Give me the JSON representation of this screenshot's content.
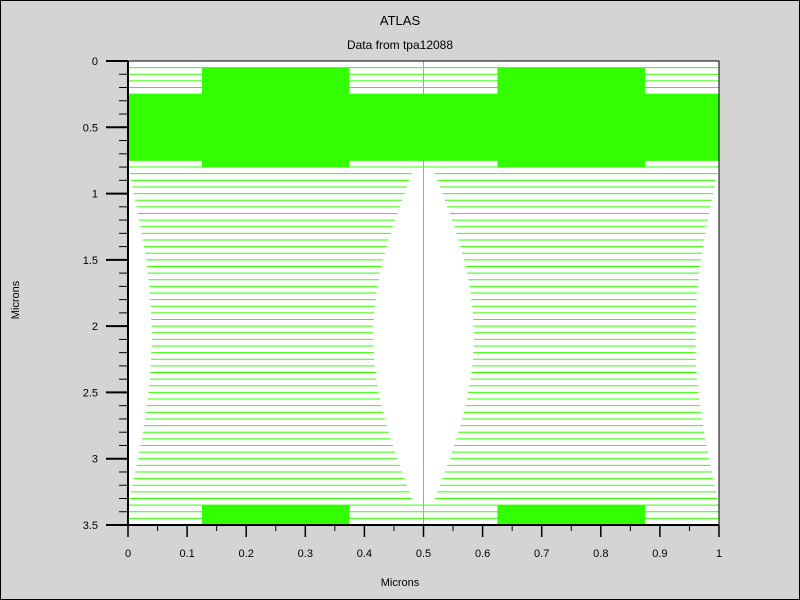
{
  "window": {
    "title": "ATLAS",
    "subtitle": "Data from tpa12088"
  },
  "colors": {
    "mesh": "#33ff00",
    "background": "#d4d4d4",
    "plot_bg": "#ffffff",
    "axis": "#000000"
  },
  "chart_data": {
    "type": "mesh",
    "title": "ATLAS",
    "subtitle": "Data from tpa12088",
    "xlabel": "Microns",
    "ylabel": "Microns",
    "xlim": [
      0,
      1
    ],
    "ylim": [
      3.5,
      0
    ],
    "y_inverted": true,
    "x_ticks": [
      "0",
      "0.1",
      "0.2",
      "0.3",
      "0.4",
      "0.5",
      "0.6",
      "0.7",
      "0.8",
      "0.9",
      "1"
    ],
    "y_ticks": [
      "0",
      "0.5",
      "1",
      "1.5",
      "2",
      "2.5",
      "3",
      "3.5"
    ],
    "dense_regions": [
      {
        "y_from": 0.25,
        "y_to": 0.75,
        "x_from": 0,
        "x_to": 1
      },
      {
        "y_from": 0.05,
        "y_to": 0.8,
        "x_from": 0.125,
        "x_to": 0.375
      },
      {
        "y_from": 0.05,
        "y_to": 0.8,
        "x_from": 0.625,
        "x_to": 0.875
      },
      {
        "y_from": 3.35,
        "y_to": 3.5,
        "x_from": 0.125,
        "x_to": 0.375
      },
      {
        "y_from": 3.35,
        "y_to": 3.5,
        "x_from": 0.625,
        "x_to": 0.875
      }
    ],
    "vertical_line_x": 0.5
  }
}
